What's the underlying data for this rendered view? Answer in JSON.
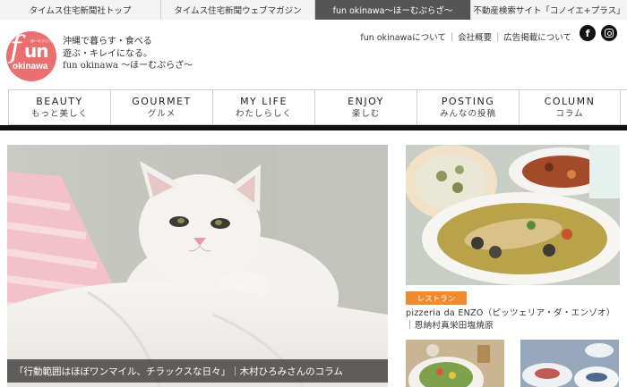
{
  "top_tabs": [
    {
      "label": "タイムス住宅新聞社トップ",
      "active": false
    },
    {
      "label": "タイムス住宅新聞ウェブマガジン",
      "active": false
    },
    {
      "label": "fun okinawa～ほーむぷらざ～",
      "active": true
    },
    {
      "label": "不動産検索サイト「コノイエ+プラス」",
      "active": false
    }
  ],
  "logo": {
    "f": "f",
    "un": "un",
    "okinawa": "okinawa",
    "kana": "ほーむぷらざ"
  },
  "tagline": {
    "line1": "沖縄で暮らす・食べる",
    "line2": "遊ぶ・キレイになる。",
    "line3": "fun okinawa ～ほーむぷらざ～"
  },
  "header_nav": [
    "fun okinawaについて",
    "会社概要",
    "広告掲載について"
  ],
  "social": {
    "facebook": "f",
    "instagram_icon": "instagram-icon"
  },
  "categories": [
    {
      "en": "BEAUTY",
      "jp": "もっと美しく"
    },
    {
      "en": "GOURMET",
      "jp": "グルメ"
    },
    {
      "en": "MY LIFE",
      "jp": "わたしらしく"
    },
    {
      "en": "ENJOY",
      "jp": "楽しむ"
    },
    {
      "en": "POSTING",
      "jp": "みんなの投稿"
    },
    {
      "en": "COLUMN",
      "jp": "コラム"
    }
  ],
  "hero": {
    "caption": "「行動範囲はほぼワンマイル、チラックスな日々」｜木村ひろみさんのコラム"
  },
  "side_article": {
    "badge": "レストラン",
    "title": "pizzeria da ENZO（ピッツェリア・ダ・エンゾオ）｜恩納村真栄田塩焼原"
  },
  "colors": {
    "active_tab": "#555555",
    "logo": "#ea6f6f",
    "badge": "#ef8a2e",
    "divider": "#111111"
  }
}
